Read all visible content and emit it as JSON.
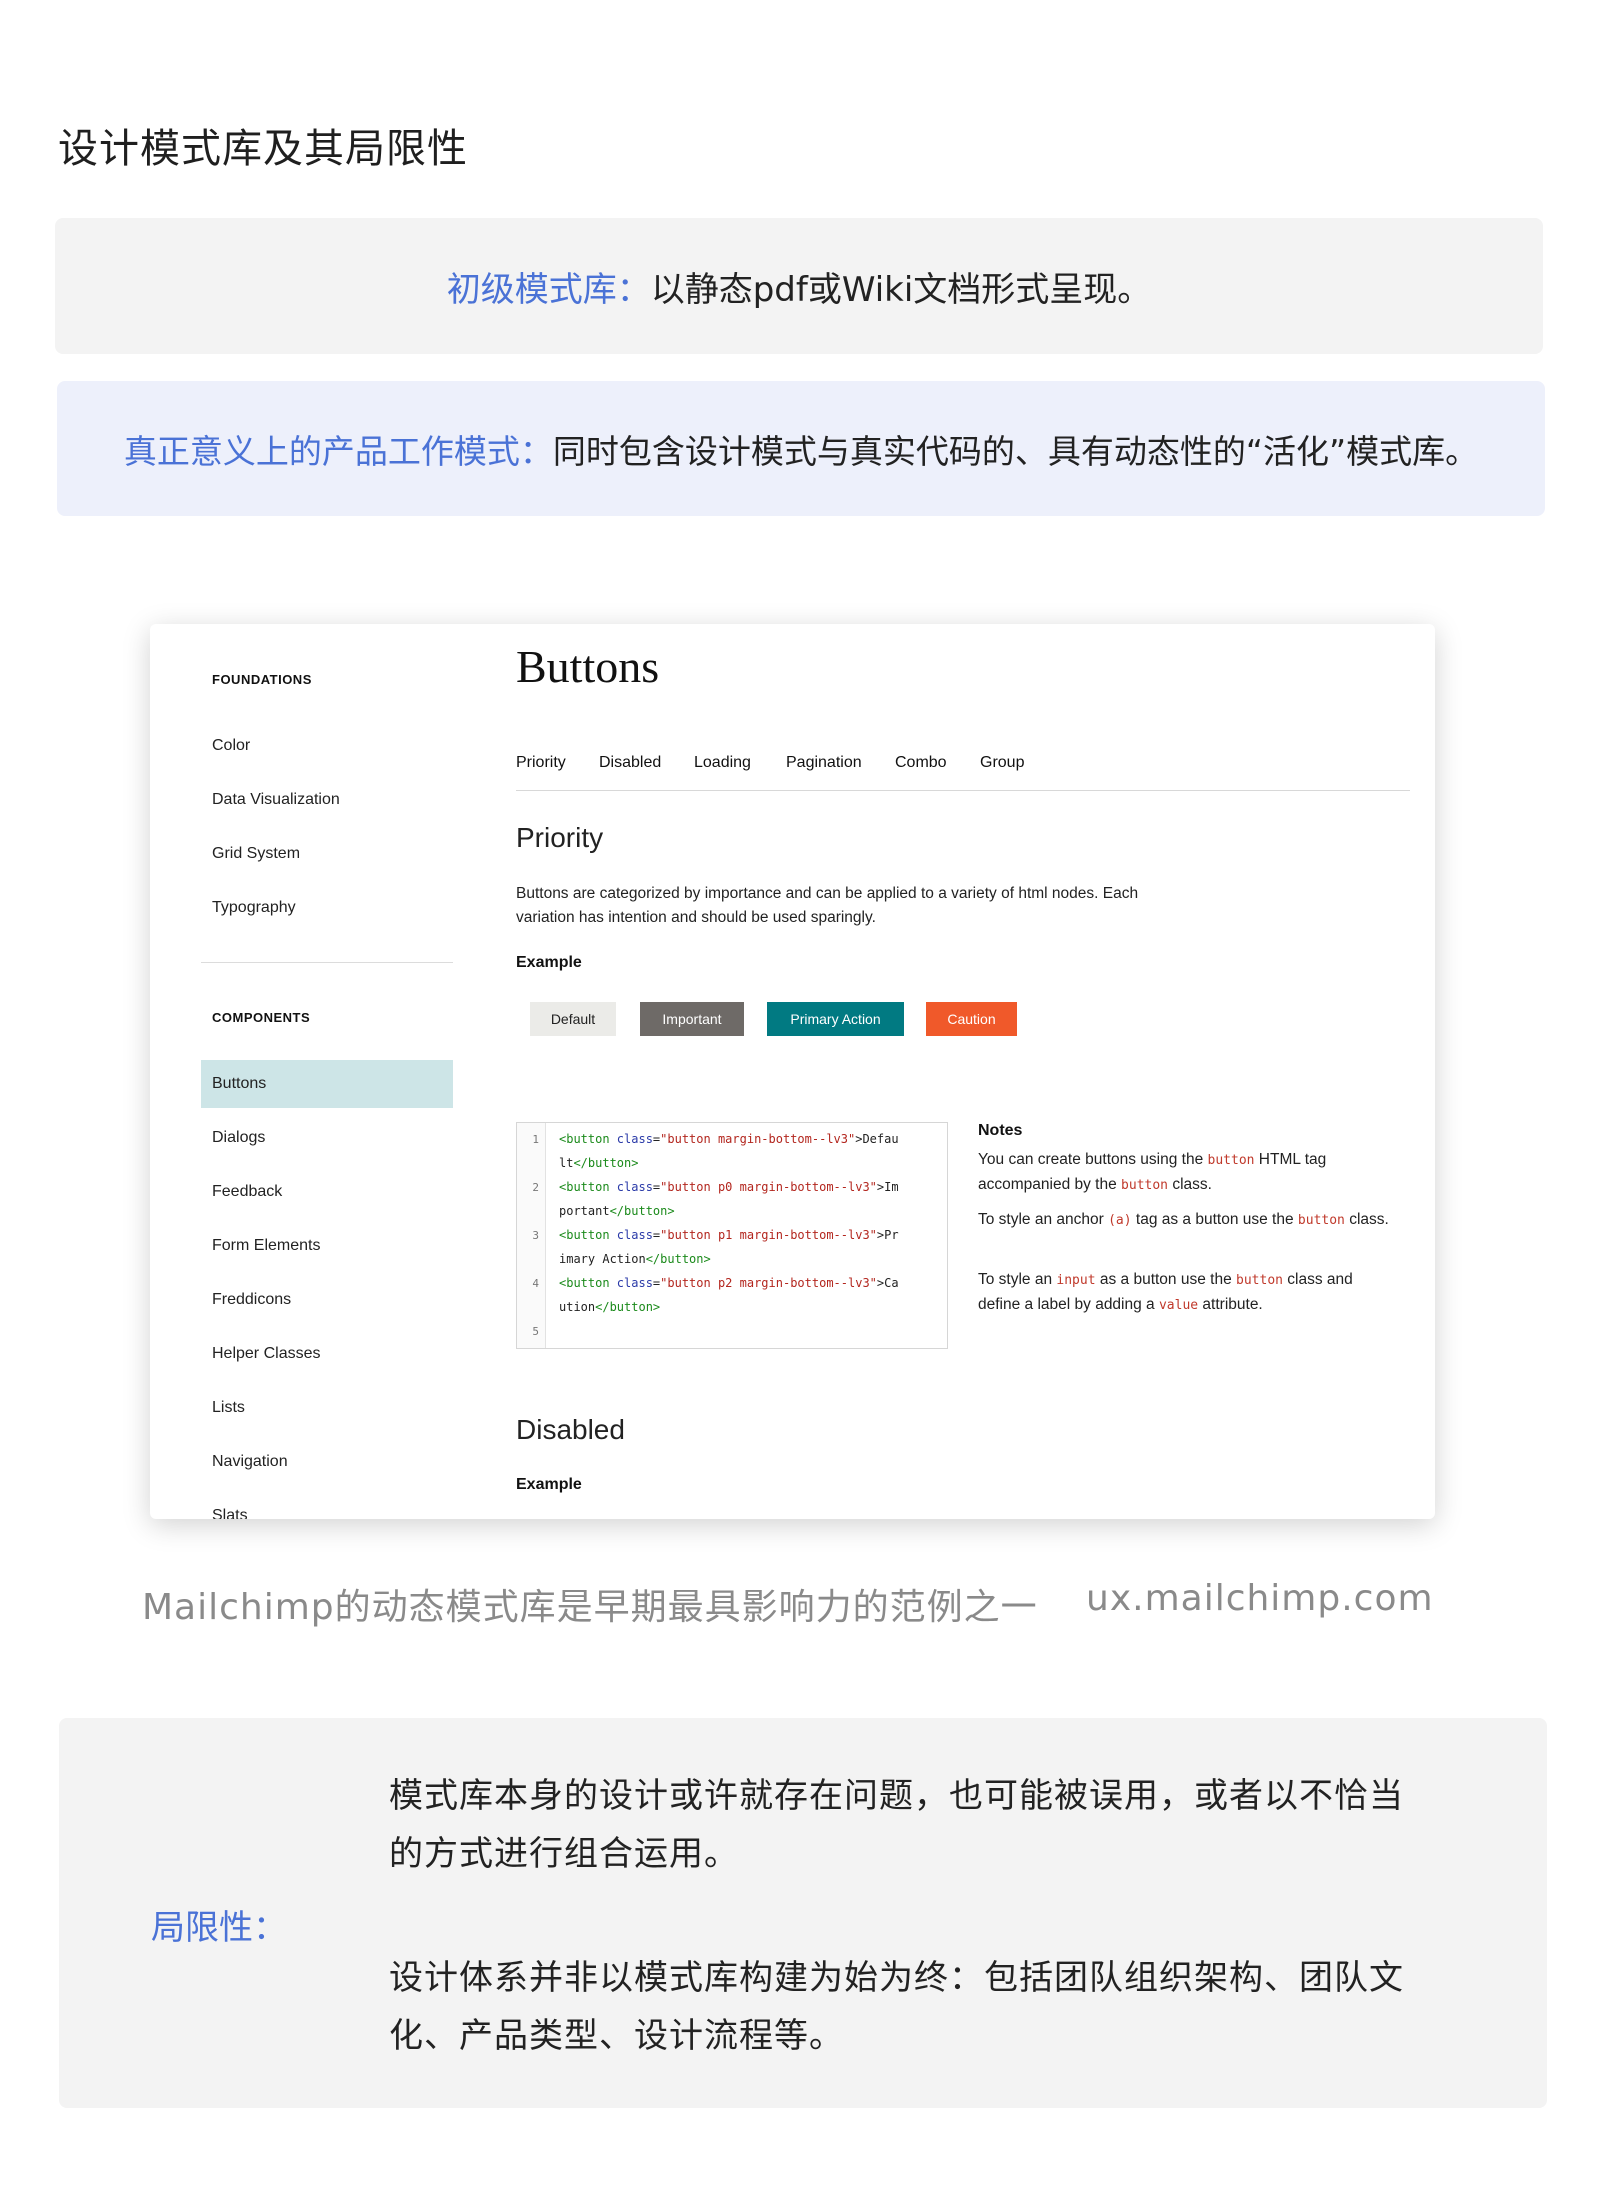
{
  "heading": "设计模式库及其局限性",
  "box1": {
    "label": "初级模式库：",
    "text": "以静态pdf或Wiki文档形式呈现。"
  },
  "box2": {
    "label": "真正意义上的产品工作模式：",
    "text": "同时包含设计模式与真实代码的、具有动态性的“活化”模式库。"
  },
  "screenshot": {
    "sidebar": {
      "foundations_heading": "FOUNDATIONS",
      "foundations": [
        "Color",
        "Data Visualization",
        "Grid System",
        "Typography"
      ],
      "components_heading": "COMPONENTS",
      "components": [
        "Buttons",
        "Dialogs",
        "Feedback",
        "Form Elements",
        "Freddicons",
        "Helper Classes",
        "Lists",
        "Navigation",
        "Slats"
      ],
      "active_item": "Buttons"
    },
    "title": "Buttons",
    "tabs": [
      "Priority",
      "Disabled",
      "Loading",
      "Pagination",
      "Combo",
      "Group"
    ],
    "priority": {
      "heading": "Priority",
      "description": "Buttons are categorized by importance and can be applied to a variety of html nodes. Each variation has intention and should be used sparingly.",
      "example_label": "Example",
      "buttons": [
        "Default",
        "Important",
        "Primary Action",
        "Caution"
      ],
      "button_colors": [
        "#ebebe8",
        "#6e6a67",
        "#017a82",
        "#f0592a"
      ]
    },
    "code": {
      "line_numbers": [
        "1",
        "2",
        "3",
        "4",
        "5"
      ],
      "lines": [
        [
          "<button ",
          "class",
          "=",
          "\"button margin-bottom--lv3\"",
          ">Defau"
        ],
        [
          "lt",
          "</button>"
        ],
        [
          "<button ",
          "class",
          "=",
          "\"button p0 margin-bottom--lv3\"",
          ">Im"
        ],
        [
          "portant",
          "</button>"
        ],
        [
          "<button ",
          "class",
          "=",
          "\"button p1 margin-bottom--lv3\"",
          ">Pr"
        ],
        [
          "imary Action",
          "</button>"
        ],
        [
          "<button ",
          "class",
          "=",
          "\"button p2 margin-bottom--lv3\"",
          ">Ca"
        ],
        [
          "ution",
          "</button>"
        ]
      ]
    },
    "notes": {
      "title": "Notes",
      "note1": {
        "a": "You can create buttons using the ",
        "code1": "button",
        "b": " HTML tag accompanied by the ",
        "code2": "button",
        "c": " class."
      },
      "note2": {
        "a": "To style an anchor ",
        "code1": "(a)",
        "b": " tag as a button use the ",
        "code2": "button",
        "c": " class."
      },
      "note3": {
        "a": "To style an ",
        "code1": "input",
        "b": " as a button use the ",
        "code2": "button",
        "c": " class and define a label by adding a ",
        "code3": "value",
        "d": " attribute."
      }
    },
    "disabled": {
      "heading": "Disabled",
      "example_label": "Example"
    }
  },
  "caption": {
    "left": "Mailchimp的动态模式库是早期最具影响力的范例之一",
    "right": "ux.mailchimp.com"
  },
  "limitations": {
    "label": "局限性：",
    "point1_line1": "模式库本身的设计或许就存在问题，也可能被误用，或者以不恰当",
    "point1_line2": "的方式进行组合运用。",
    "point2_line1": "设计体系并非以模式库构建为始为终：包括团队组织架构、团队文",
    "point2_line2": "化、产品类型、设计流程等。"
  }
}
